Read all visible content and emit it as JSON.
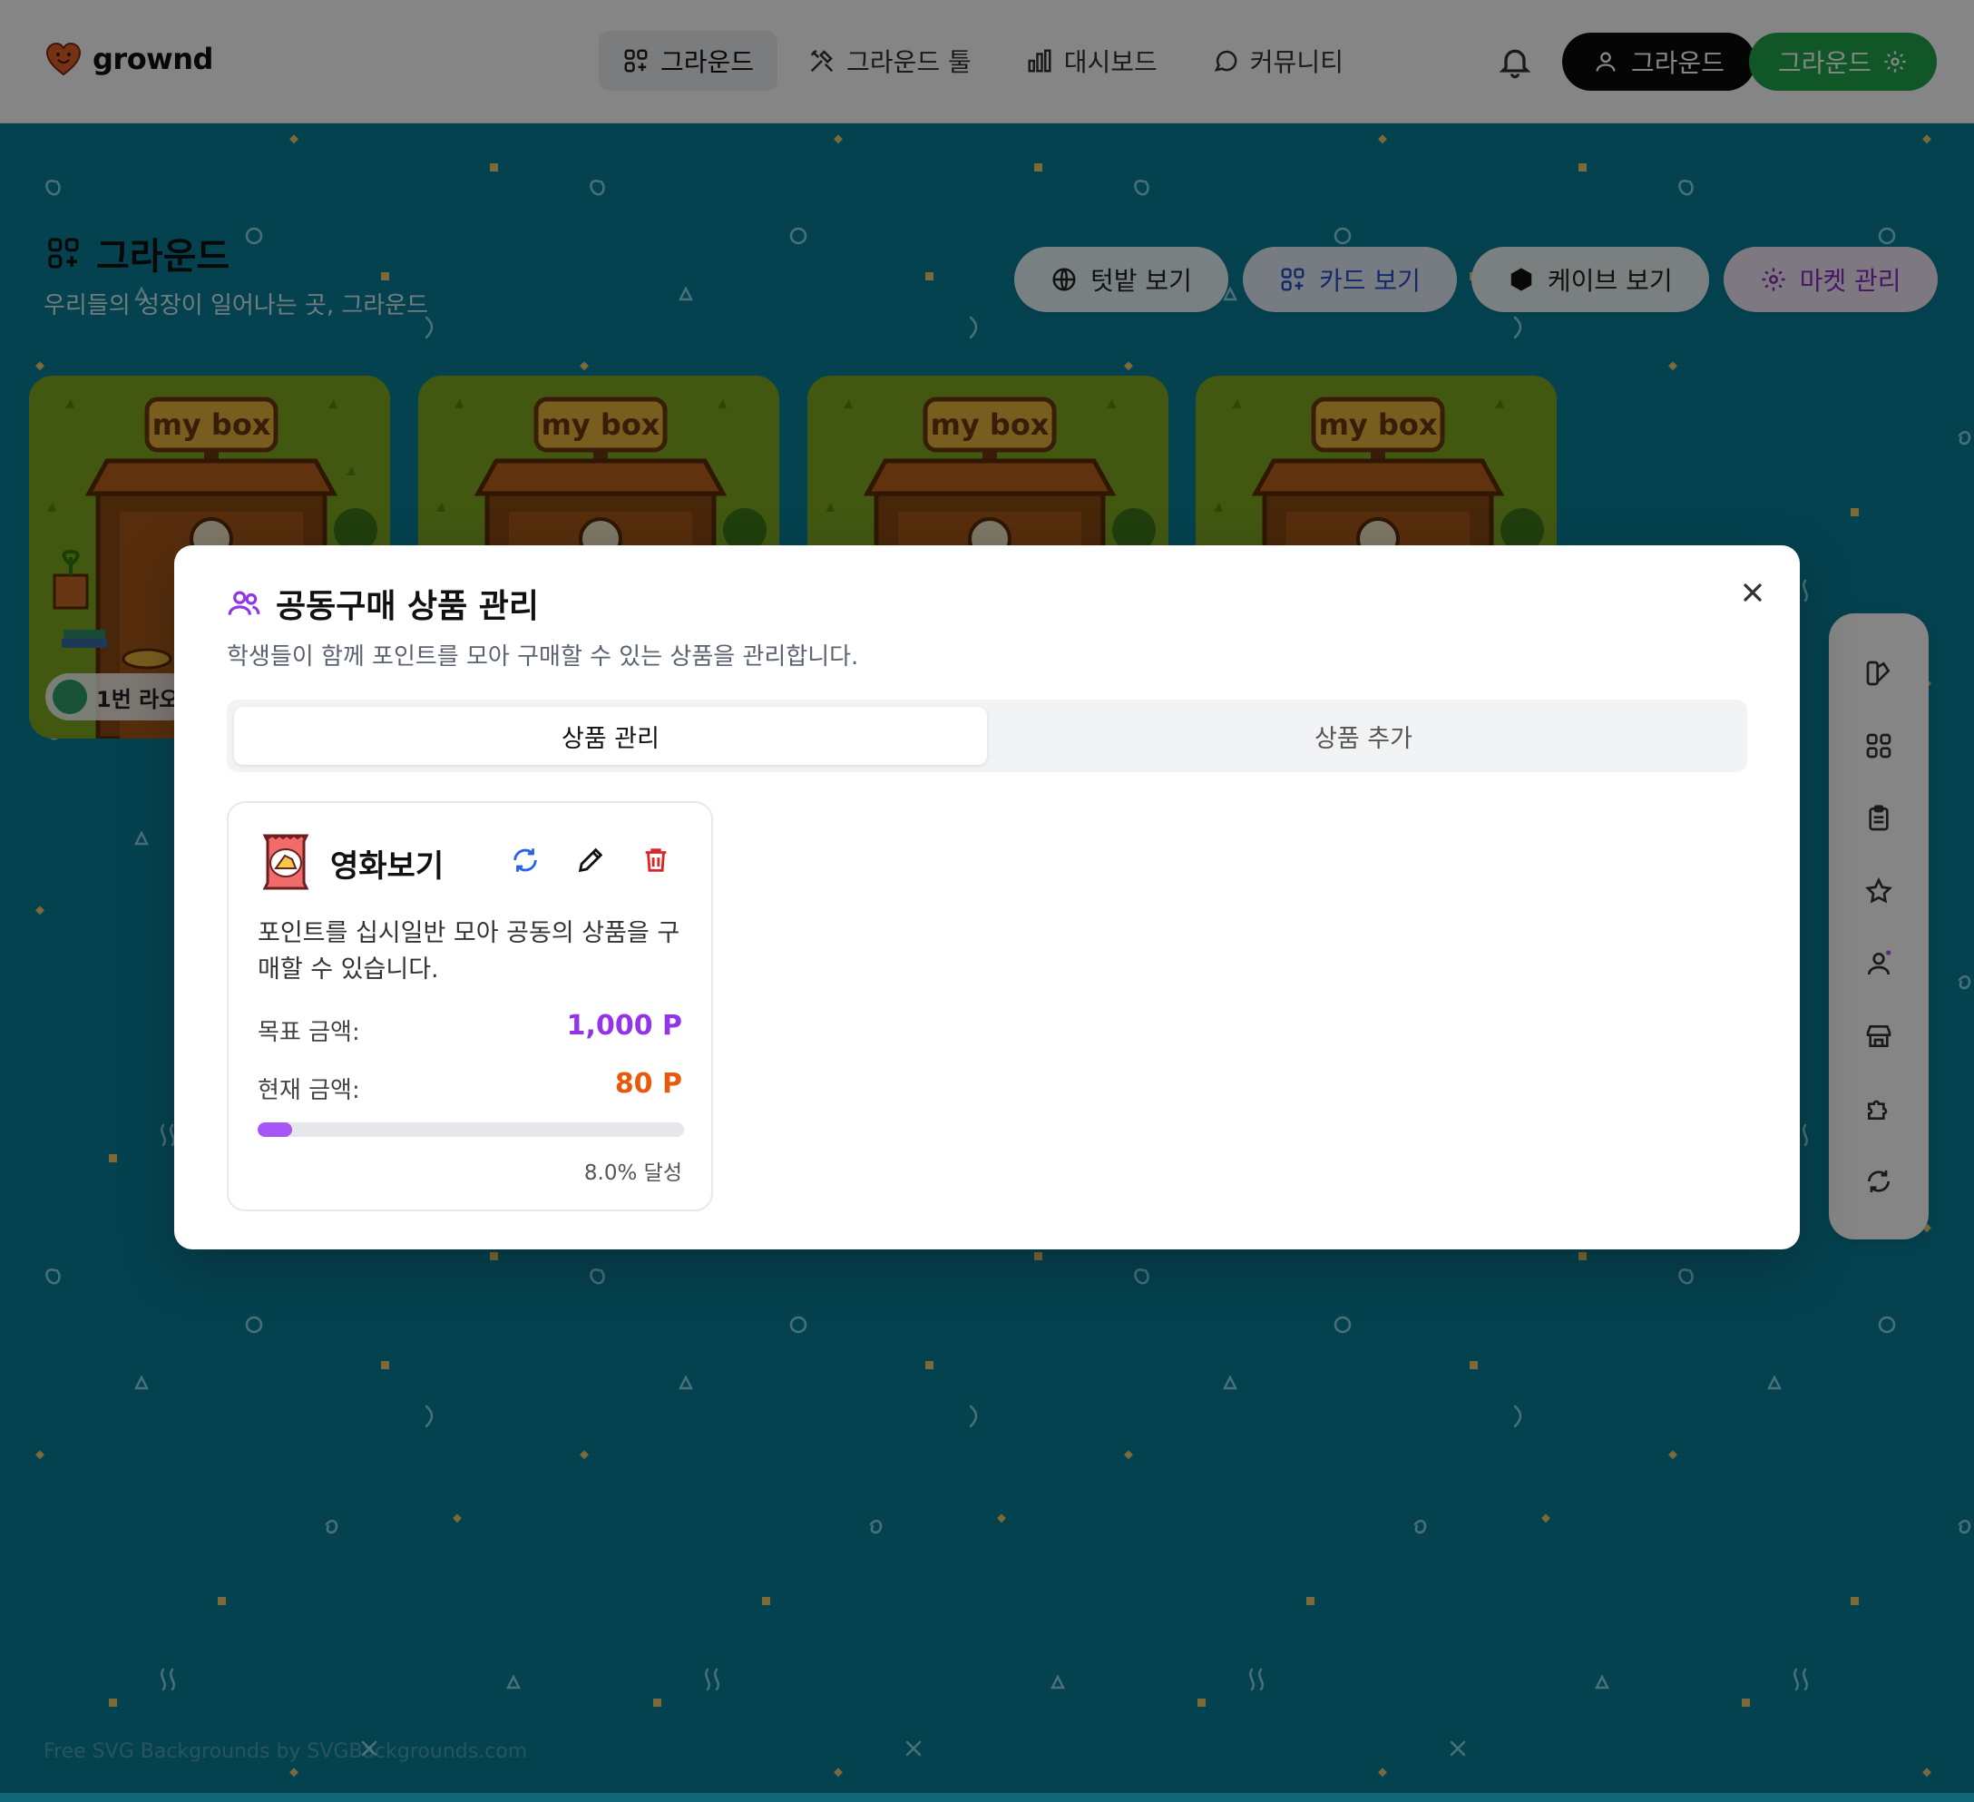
{
  "brand": {
    "name": "grownd"
  },
  "nav": {
    "items": [
      {
        "label": "그라운드",
        "icon": "grid-plus-icon",
        "active": true
      },
      {
        "label": "그라운드 툴",
        "icon": "tools-icon",
        "active": false
      },
      {
        "label": "대시보드",
        "icon": "bar-chart-icon",
        "active": false
      },
      {
        "label": "커뮤니티",
        "icon": "chat-bubble-icon",
        "active": false
      }
    ],
    "user_button": "그라운드",
    "settings_button": "그라운드"
  },
  "page": {
    "title": "그라운드",
    "subtitle": "우리들의 성장이 일어나는 곳, 그라운드"
  },
  "view_buttons": [
    {
      "label": "텃밭 보기",
      "icon": "globe-icon"
    },
    {
      "label": "카드 보기",
      "icon": "grid-plus-icon"
    },
    {
      "label": "케이브 보기",
      "icon": "hexagon-icon"
    },
    {
      "label": "마켓 관리",
      "icon": "gear-icon"
    }
  ],
  "cards": [
    {
      "sign": "my box",
      "label": "1번 라오"
    },
    {
      "sign": "my box"
    },
    {
      "sign": "my box"
    },
    {
      "sign": "my box"
    }
  ],
  "side_toolbar": [
    "paint-icon",
    "grid-icon",
    "clipboard-icon",
    "star-icon",
    "user-icon",
    "store-icon",
    "puzzle-icon",
    "refresh-icon"
  ],
  "modal": {
    "title": "공동구매 상품 관리",
    "description": "학생들이 함께 포인트를 모아 구매할 수 있는 상품을 관리합니다.",
    "tabs": [
      {
        "label": "상품 관리",
        "active": true
      },
      {
        "label": "상품 추가",
        "active": false
      }
    ],
    "product": {
      "name": "영화보기",
      "icon": "snack-bag-icon",
      "description": "포인트를 십시일반 모아 공동의 상품을 구매할 수 있습니다.",
      "goal_label": "목표 금액:",
      "goal_value": "1,000 P",
      "current_label": "현재 금액:",
      "current_value": "80 P",
      "progress_fraction": 0.08,
      "progress_text": "8.0% 달성"
    }
  },
  "background_credit": "Free SVG Backgrounds by SVGBackgrounds.com",
  "colors": {
    "background": "#0a7f99",
    "accent_green": "#1fa54b",
    "goal_purple": "#9333ea",
    "current_orange": "#ea580c",
    "progress_purple": "#a855f7"
  }
}
